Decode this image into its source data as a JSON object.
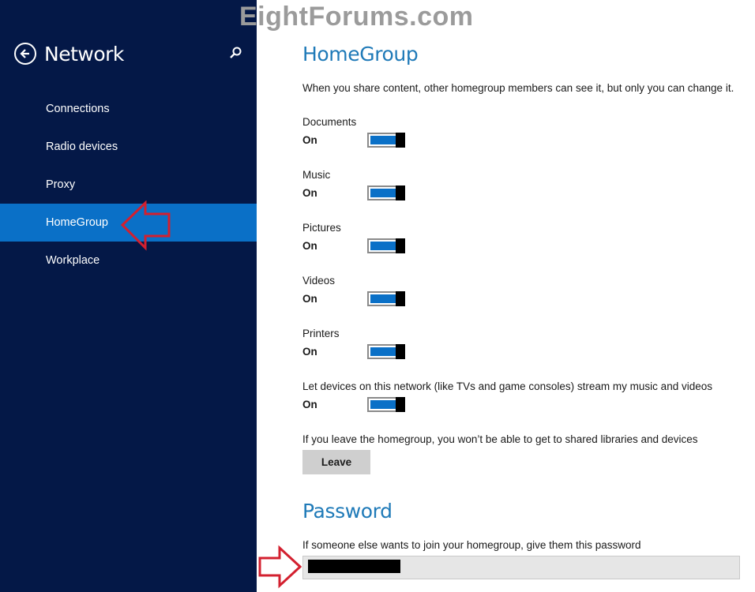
{
  "watermark": "EightForums.com",
  "sidebar": {
    "title": "Network",
    "back_icon": "back-arrow-circle-icon",
    "search_icon": "search-icon",
    "items": [
      {
        "label": "Connections"
      },
      {
        "label": "Radio devices"
      },
      {
        "label": "Proxy"
      },
      {
        "label": "HomeGroup",
        "active": true
      },
      {
        "label": "Workplace"
      }
    ]
  },
  "homegroup": {
    "heading": "HomeGroup",
    "description": "When you share content, other homegroup members can see it, but only you can change it.",
    "toggles": [
      {
        "label": "Documents",
        "state": "On"
      },
      {
        "label": "Music",
        "state": "On"
      },
      {
        "label": "Pictures",
        "state": "On"
      },
      {
        "label": "Videos",
        "state": "On"
      },
      {
        "label": "Printers",
        "state": "On"
      },
      {
        "label": "Let devices on this network (like TVs and game consoles) stream my music and videos",
        "state": "On"
      }
    ],
    "leave_note": "If you leave the homegroup, you won’t be able to get to shared libraries and devices",
    "leave_button": "Leave"
  },
  "password": {
    "heading": "Password",
    "description": "If someone else wants to join your homegroup, give them this password"
  },
  "colors": {
    "sidebar_bg": "#041847",
    "active_item": "#0a70c7",
    "heading": "#1f7ab8",
    "annotation_arrow": "#d3202f"
  }
}
